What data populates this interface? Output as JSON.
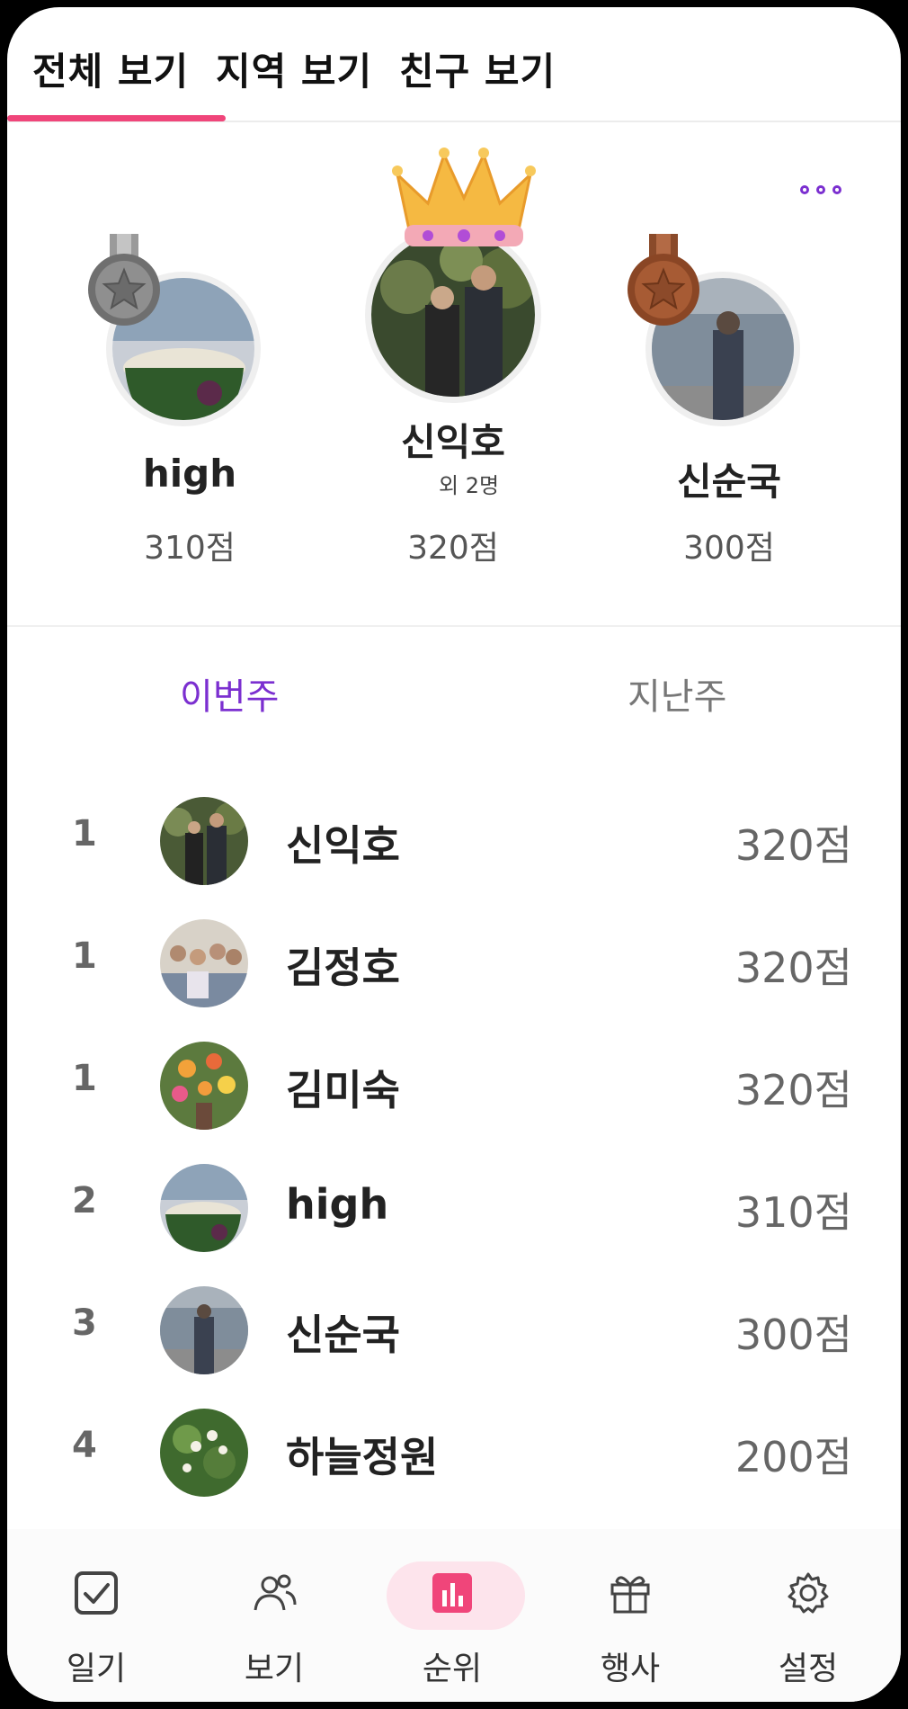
{
  "tabs": [
    {
      "label": "전체 보기"
    },
    {
      "label": "지역 보기"
    },
    {
      "label": "친구 보기"
    }
  ],
  "podium": {
    "first": {
      "name": "신익호",
      "sub": "외 2명",
      "score": "320점"
    },
    "second": {
      "name": "high",
      "score": "310점"
    },
    "third": {
      "name": "신순국",
      "score": "300점"
    }
  },
  "period": {
    "this_week": "이번주",
    "last_week": "지난주"
  },
  "ranking": [
    {
      "rank": "1",
      "name": "신익호",
      "score": "320점"
    },
    {
      "rank": "1",
      "name": "김정호",
      "score": "320점"
    },
    {
      "rank": "1",
      "name": "김미숙",
      "score": "320점"
    },
    {
      "rank": "2",
      "name": "high",
      "score": "310점"
    },
    {
      "rank": "3",
      "name": "신순국",
      "score": "300점"
    },
    {
      "rank": "4",
      "name": "하늘정원",
      "score": "200점"
    }
  ],
  "nav": [
    {
      "label": "일기",
      "icon": "checkbox-icon"
    },
    {
      "label": "보기",
      "icon": "people-icon"
    },
    {
      "label": "순위",
      "icon": "bar-chart-icon"
    },
    {
      "label": "행사",
      "icon": "gift-icon"
    },
    {
      "label": "설정",
      "icon": "gear-icon"
    }
  ],
  "colors": {
    "accent_pink": "#f0457a",
    "accent_purple": "#7b2fd0",
    "silver": "#8c8c8c",
    "bronze": "#a0522d",
    "gold": "#f5b942"
  }
}
